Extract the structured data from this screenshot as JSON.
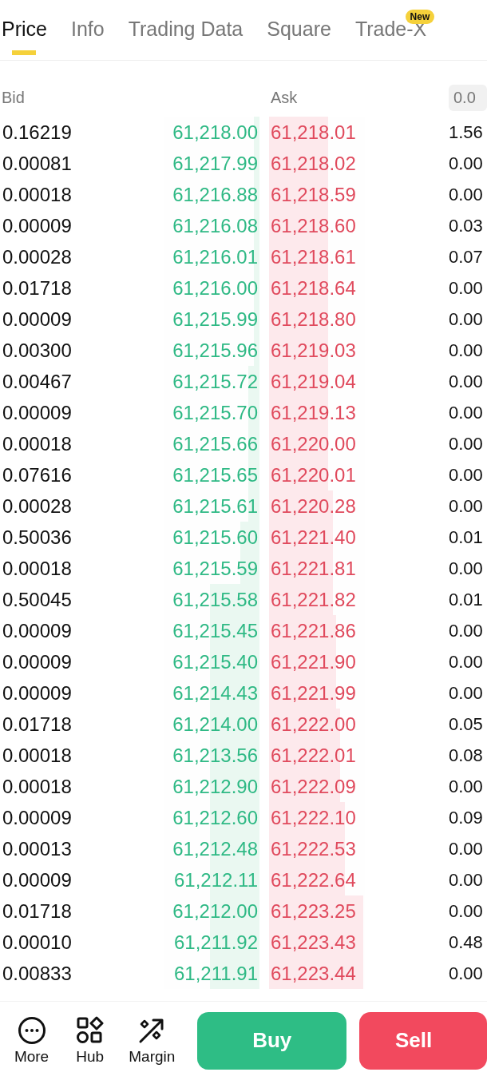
{
  "tabs": [
    {
      "label": "Price",
      "selected": true
    },
    {
      "label": "Info",
      "selected": false
    },
    {
      "label": "Trading Data",
      "selected": false
    },
    {
      "label": "Square",
      "selected": false
    },
    {
      "label": "Trade-X",
      "selected": false,
      "badge": "New"
    }
  ],
  "order_book": {
    "bid_header": "Bid",
    "ask_header": "Ask",
    "precision": "0.0",
    "rows": [
      {
        "bid_amount": "0.16219",
        "bid_price": "61,218.00",
        "bid_depth": {
          "level": 0.06
        },
        "ask_price": "61,218.01",
        "ask_depth": {
          "level": 0.62
        },
        "ask_amount": "1.56"
      },
      {
        "bid_amount": "0.00081",
        "bid_price": "61,217.99",
        "bid_depth": {
          "level": 0.06
        },
        "ask_price": "61,218.02",
        "ask_depth": {
          "level": 0.62
        },
        "ask_amount": "0.00"
      },
      {
        "bid_amount": "0.00018",
        "bid_price": "61,216.88",
        "bid_depth": {
          "level": 0.06
        },
        "ask_price": "61,218.59",
        "ask_depth": {
          "level": 0.62
        },
        "ask_amount": "0.00"
      },
      {
        "bid_amount": "0.00009",
        "bid_price": "61,216.08",
        "bid_depth": {
          "level": 0.06
        },
        "ask_price": "61,218.60",
        "ask_depth": {
          "level": 0.62
        },
        "ask_amount": "0.03"
      },
      {
        "bid_amount": "0.00028",
        "bid_price": "61,216.01",
        "bid_depth": {
          "level": 0.06
        },
        "ask_price": "61,218.61",
        "ask_depth": {
          "level": 0.62
        },
        "ask_amount": "0.07"
      },
      {
        "bid_amount": "0.01718",
        "bid_price": "61,216.00",
        "bid_depth": {
          "level": 0.06
        },
        "ask_price": "61,218.64",
        "ask_depth": {
          "level": 0.62
        },
        "ask_amount": "0.00"
      },
      {
        "bid_amount": "0.00009",
        "bid_price": "61,215.99",
        "bid_depth": {
          "level": 0.06
        },
        "ask_price": "61,218.80",
        "ask_depth": {
          "level": 0.62
        },
        "ask_amount": "0.00"
      },
      {
        "bid_amount": "0.00300",
        "bid_price": "61,215.96",
        "bid_depth": {
          "level": 0.06
        },
        "ask_price": "61,219.03",
        "ask_depth": {
          "level": 0.62
        },
        "ask_amount": "0.00"
      },
      {
        "bid_amount": "0.00467",
        "bid_price": "61,215.72",
        "bid_depth": {
          "level": 0.12
        },
        "ask_price": "61,219.04",
        "ask_depth": {
          "level": 0.62
        },
        "ask_amount": "0.00"
      },
      {
        "bid_amount": "0.00009",
        "bid_price": "61,215.70",
        "bid_depth": {
          "level": 0.12
        },
        "ask_price": "61,219.13",
        "ask_depth": {
          "level": 0.62
        },
        "ask_amount": "0.00"
      },
      {
        "bid_amount": "0.00018",
        "bid_price": "61,215.66",
        "bid_depth": {
          "level": 0.12
        },
        "ask_price": "61,220.00",
        "ask_depth": {
          "level": 0.62
        },
        "ask_amount": "0.00"
      },
      {
        "bid_amount": "0.07616",
        "bid_price": "61,215.65",
        "bid_depth": {
          "level": 0.12
        },
        "ask_price": "61,220.01",
        "ask_depth": {
          "level": 0.62
        },
        "ask_amount": "0.00"
      },
      {
        "bid_amount": "0.00028",
        "bid_price": "61,215.61",
        "bid_depth": {
          "level": 0.12
        },
        "ask_price": "61,220.28",
        "ask_depth": {
          "level": 0.67
        },
        "ask_amount": "0.00"
      },
      {
        "bid_amount": "0.50036",
        "bid_price": "61,215.60",
        "bid_depth": {
          "level": 0.2
        },
        "ask_price": "61,221.40",
        "ask_depth": {
          "level": 0.67
        },
        "ask_amount": "0.01"
      },
      {
        "bid_amount": "0.00018",
        "bid_price": "61,215.59",
        "bid_depth": {
          "level": 0.2
        },
        "ask_price": "61,221.81",
        "ask_depth": {
          "level": 0.67
        },
        "ask_amount": "0.00"
      },
      {
        "bid_amount": "0.50045",
        "bid_price": "61,215.58",
        "bid_depth": {
          "level": 0.52
        },
        "ask_price": "61,221.82",
        "ask_depth": {
          "level": 0.67
        },
        "ask_amount": "0.01"
      },
      {
        "bid_amount": "0.00009",
        "bid_price": "61,215.45",
        "bid_depth": {
          "level": 0.52
        },
        "ask_price": "61,221.86",
        "ask_depth": {
          "level": 0.7
        },
        "ask_amount": "0.00"
      },
      {
        "bid_amount": "0.00009",
        "bid_price": "61,215.40",
        "bid_depth": {
          "level": 0.52
        },
        "ask_price": "61,221.90",
        "ask_depth": {
          "level": 0.7
        },
        "ask_amount": "0.00"
      },
      {
        "bid_amount": "0.00009",
        "bid_price": "61,214.43",
        "bid_depth": {
          "level": 0.52
        },
        "ask_price": "61,221.99",
        "ask_depth": {
          "level": 0.7
        },
        "ask_amount": "0.00"
      },
      {
        "bid_amount": "0.01718",
        "bid_price": "61,214.00",
        "bid_depth": {
          "level": 0.52
        },
        "ask_price": "61,222.00",
        "ask_depth": {
          "level": 0.74
        },
        "ask_amount": "0.05"
      },
      {
        "bid_amount": "0.00018",
        "bid_price": "61,213.56",
        "bid_depth": {
          "level": 0.52
        },
        "ask_price": "61,222.01",
        "ask_depth": {
          "level": 0.74
        },
        "ask_amount": "0.08"
      },
      {
        "bid_amount": "0.00018",
        "bid_price": "61,212.90",
        "bid_depth": {
          "level": 0.52
        },
        "ask_price": "61,222.09",
        "ask_depth": {
          "level": 0.74
        },
        "ask_amount": "0.00"
      },
      {
        "bid_amount": "0.00009",
        "bid_price": "61,212.60",
        "bid_depth": {
          "level": 0.52
        },
        "ask_price": "61,222.10",
        "ask_depth": {
          "level": 0.79
        },
        "ask_amount": "0.09"
      },
      {
        "bid_amount": "0.00013",
        "bid_price": "61,212.48",
        "bid_depth": {
          "level": 0.52
        },
        "ask_price": "61,222.53",
        "ask_depth": {
          "level": 0.79
        },
        "ask_amount": "0.00"
      },
      {
        "bid_amount": "0.00009",
        "bid_price": "61,212.11",
        "bid_depth": {
          "level": 0.52
        },
        "ask_price": "61,222.64",
        "ask_depth": {
          "level": 0.79
        },
        "ask_amount": "0.00"
      },
      {
        "bid_amount": "0.01718",
        "bid_price": "61,212.00",
        "bid_depth": {
          "level": 0.52
        },
        "ask_price": "61,223.25",
        "ask_depth": {
          "level": 0.98
        },
        "ask_amount": "0.00"
      },
      {
        "bid_amount": "0.00010",
        "bid_price": "61,211.92",
        "bid_depth": {
          "level": 0.52
        },
        "ask_price": "61,223.43",
        "ask_depth": {
          "level": 0.98
        },
        "ask_amount": "0.48"
      },
      {
        "bid_amount": "0.00833",
        "bid_price": "61,211.91",
        "bid_depth": {
          "level": 0.52
        },
        "ask_price": "61,223.44",
        "ask_depth": {
          "level": 0.98
        },
        "ask_amount": "0.00"
      }
    ]
  },
  "bottom_bar": {
    "tools": [
      {
        "kind": "more",
        "label": "More"
      },
      {
        "kind": "hub",
        "label": "Hub"
      },
      {
        "kind": "margin",
        "label": "Margin"
      }
    ],
    "buy": "Buy",
    "sell": "Sell"
  }
}
